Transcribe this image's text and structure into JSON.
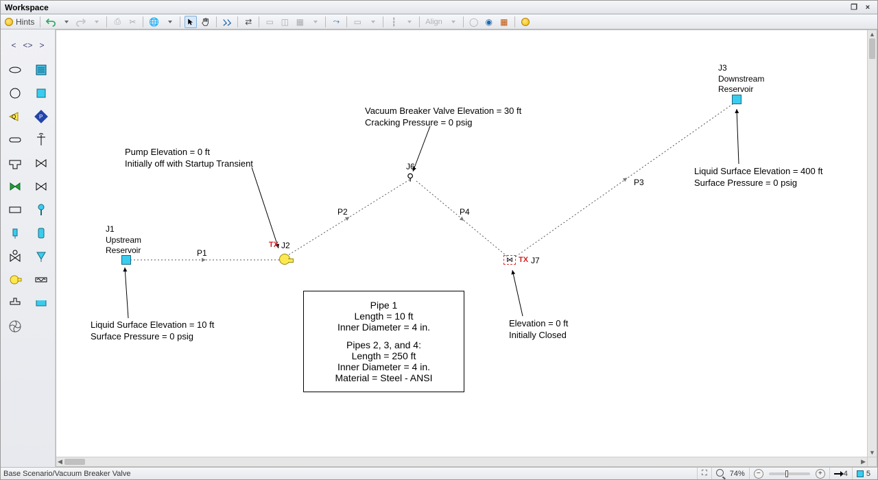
{
  "window": {
    "title": "Workspace",
    "minimize": "_",
    "maximize": "□",
    "close": "×"
  },
  "toolbar": {
    "hints": "Hints",
    "align": "Align"
  },
  "statusbar": {
    "path": "Base Scenario/Vacuum Breaker Valve",
    "zoom": "74%",
    "pipe_count": "4",
    "junction_count": "5"
  },
  "diagram": {
    "j1": {
      "id": "J1",
      "name": "Upstream",
      "type": "Reservoir"
    },
    "j2": {
      "id": "J2",
      "tx": "TX"
    },
    "j3": {
      "id": "J3",
      "name": "Downstream",
      "type": "Reservoir"
    },
    "j6": {
      "id": "J6"
    },
    "j7": {
      "id": "J7",
      "tx": "TX"
    },
    "pipes": {
      "p1": "P1",
      "p2": "P2",
      "p3": "P3",
      "p4": "P4"
    },
    "annotations": {
      "j1_a": "Liquid Surface Elevation = 10 ft",
      "j1_b": "Surface Pressure = 0 psig",
      "j2_a": "Pump Elevation = 0 ft",
      "j2_b": "Initially off with Startup Transient",
      "j6_a": "Vacuum Breaker Valve Elevation = 30 ft",
      "j6_b": "Cracking Pressure = 0 psig",
      "j7_a": "Elevation = 0 ft",
      "j7_b": "Initially Closed",
      "j3_a": "Liquid Surface Elevation = 400 ft",
      "j3_b": "Surface Pressure = 0 psig"
    },
    "info_box": {
      "l1": "Pipe 1",
      "l2": "Length = 10 ft",
      "l3": "Inner Diameter = 4 in.",
      "l4": "Pipes 2, 3, and 4:",
      "l5": "Length = 250 ft",
      "l6": "Inner Diameter = 4 in.",
      "l7": "Material = Steel - ANSI"
    }
  }
}
